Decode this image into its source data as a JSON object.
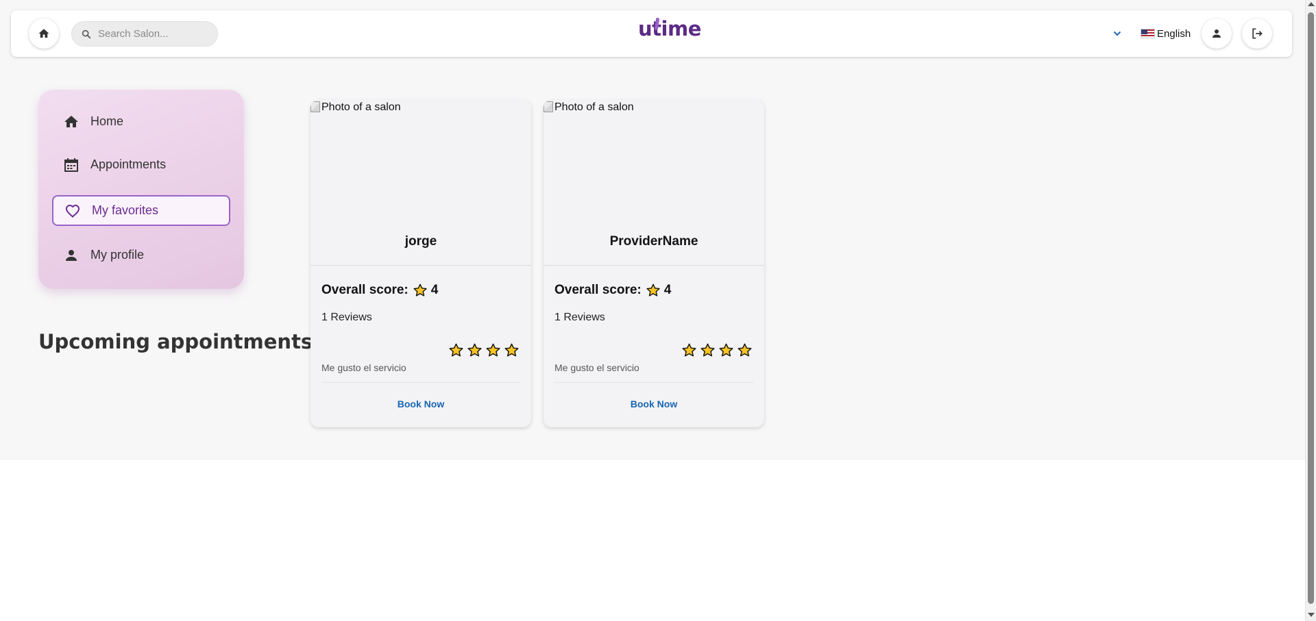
{
  "header": {
    "search_placeholder": "Search Salon...",
    "logo_text_before": "u",
    "logo_text_t": "t",
    "logo_text_after": "ime",
    "language_label": "English"
  },
  "sidebar": {
    "items": [
      {
        "label": "Home",
        "icon": "home-icon",
        "active": false
      },
      {
        "label": "Appointments",
        "icon": "calendar-icon",
        "active": false
      },
      {
        "label": "My favorites",
        "icon": "heart-icon",
        "active": true
      },
      {
        "label": "My profile",
        "icon": "person-icon",
        "active": false
      }
    ]
  },
  "main": {
    "upcoming_title": "Upcoming appointments"
  },
  "cards": [
    {
      "photo_alt": "Photo of a salon",
      "name": "jorge",
      "score_label": "Overall score:",
      "score_value": "4",
      "reviews": "1 Reviews",
      "rating": 4,
      "comment": "Me gusto el servicio",
      "book_label": "Book Now"
    },
    {
      "photo_alt": "Photo of a salon",
      "name": "ProviderName",
      "score_label": "Overall score:",
      "score_value": "4",
      "reviews": "1 Reviews",
      "rating": 4,
      "comment": "Me gusto el servicio",
      "book_label": "Book Now"
    }
  ],
  "colors": {
    "brand": "#5b2a86",
    "accent": "#9a62c6",
    "link": "#1765b3",
    "star": "#f7c325"
  }
}
